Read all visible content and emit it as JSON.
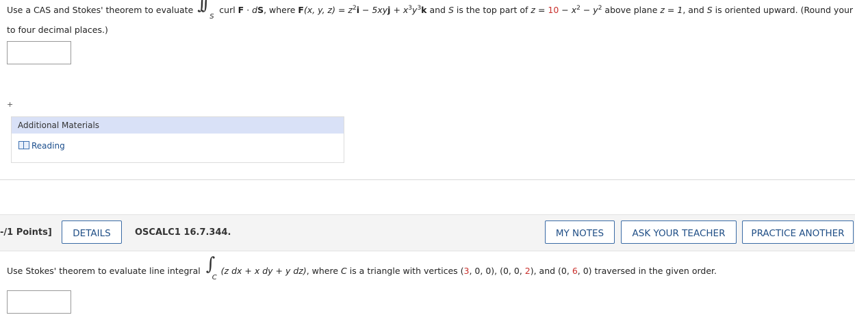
{
  "q1": {
    "prefix": "Use a CAS and Stokes' theorem to evaluate",
    "integral_symbol": "∫∫",
    "integral_sub": "S",
    "t_curl": "curl ",
    "t_F1": "F",
    "t_dot": " · ",
    "t_d": "d",
    "t_S1": "S",
    "t_where": ", where ",
    "t_F2": "F",
    "t_args": "(x, y, z) = z",
    "t_sq1": "2",
    "t_i": "i",
    "t_minus5": " − 5xy",
    "t_j": "j",
    "t_plus": " + x",
    "t_cube1": "3",
    "t_y": "y",
    "t_cube2": "3",
    "t_k": "k",
    "t_and": " and ",
    "t_S2": "S",
    "t_istop": " is the top part of ",
    "t_zeq": "z = ",
    "t_ten": "10",
    "t_minusx": " − x",
    "t_sq2": "2",
    "t_minusy": " − y",
    "t_sq3": "2",
    "t_above": " above plane ",
    "t_zeq1": "z = 1",
    "t_andS": ", and ",
    "t_S3": "S",
    "t_oriented": " is oriented upward. (Round your answer",
    "line2": "to four decimal places.)",
    "answer_value": ""
  },
  "plus_sign": "+",
  "additional_materials": {
    "heading": "Additional Materials",
    "link": "Reading",
    "icon": "book-icon"
  },
  "question_bar": {
    "points": "-/1 Points]",
    "details": "DETAILS",
    "id": "OSCALC1 16.7.344.",
    "my_notes": "MY NOTES",
    "ask_teacher": "ASK YOUR TEACHER",
    "practice": "PRACTICE ANOTHER"
  },
  "q2": {
    "prefix": "Use Stokes' theorem to evaluate line integral",
    "integral_symbol": "∫",
    "integral_sub": "C",
    "t_expr": "(z dx + x dy + y dz)",
    "t_where": ", where ",
    "t_C": "C",
    "t_tri": " is a triangle with vertices (",
    "t_v1a": "3",
    "t_v1b": ", 0, 0), (0, 0, ",
    "t_v2": "2",
    "t_v2b": "), and (0, ",
    "t_v3": "6",
    "t_v3b": ", 0) traversed in the given order.",
    "answer_value": ""
  },
  "colors": {
    "red": "#c9302c",
    "link": "#1a4d8c",
    "button_border": "#3a6ba5",
    "header_bg": "#d9e1f7"
  }
}
